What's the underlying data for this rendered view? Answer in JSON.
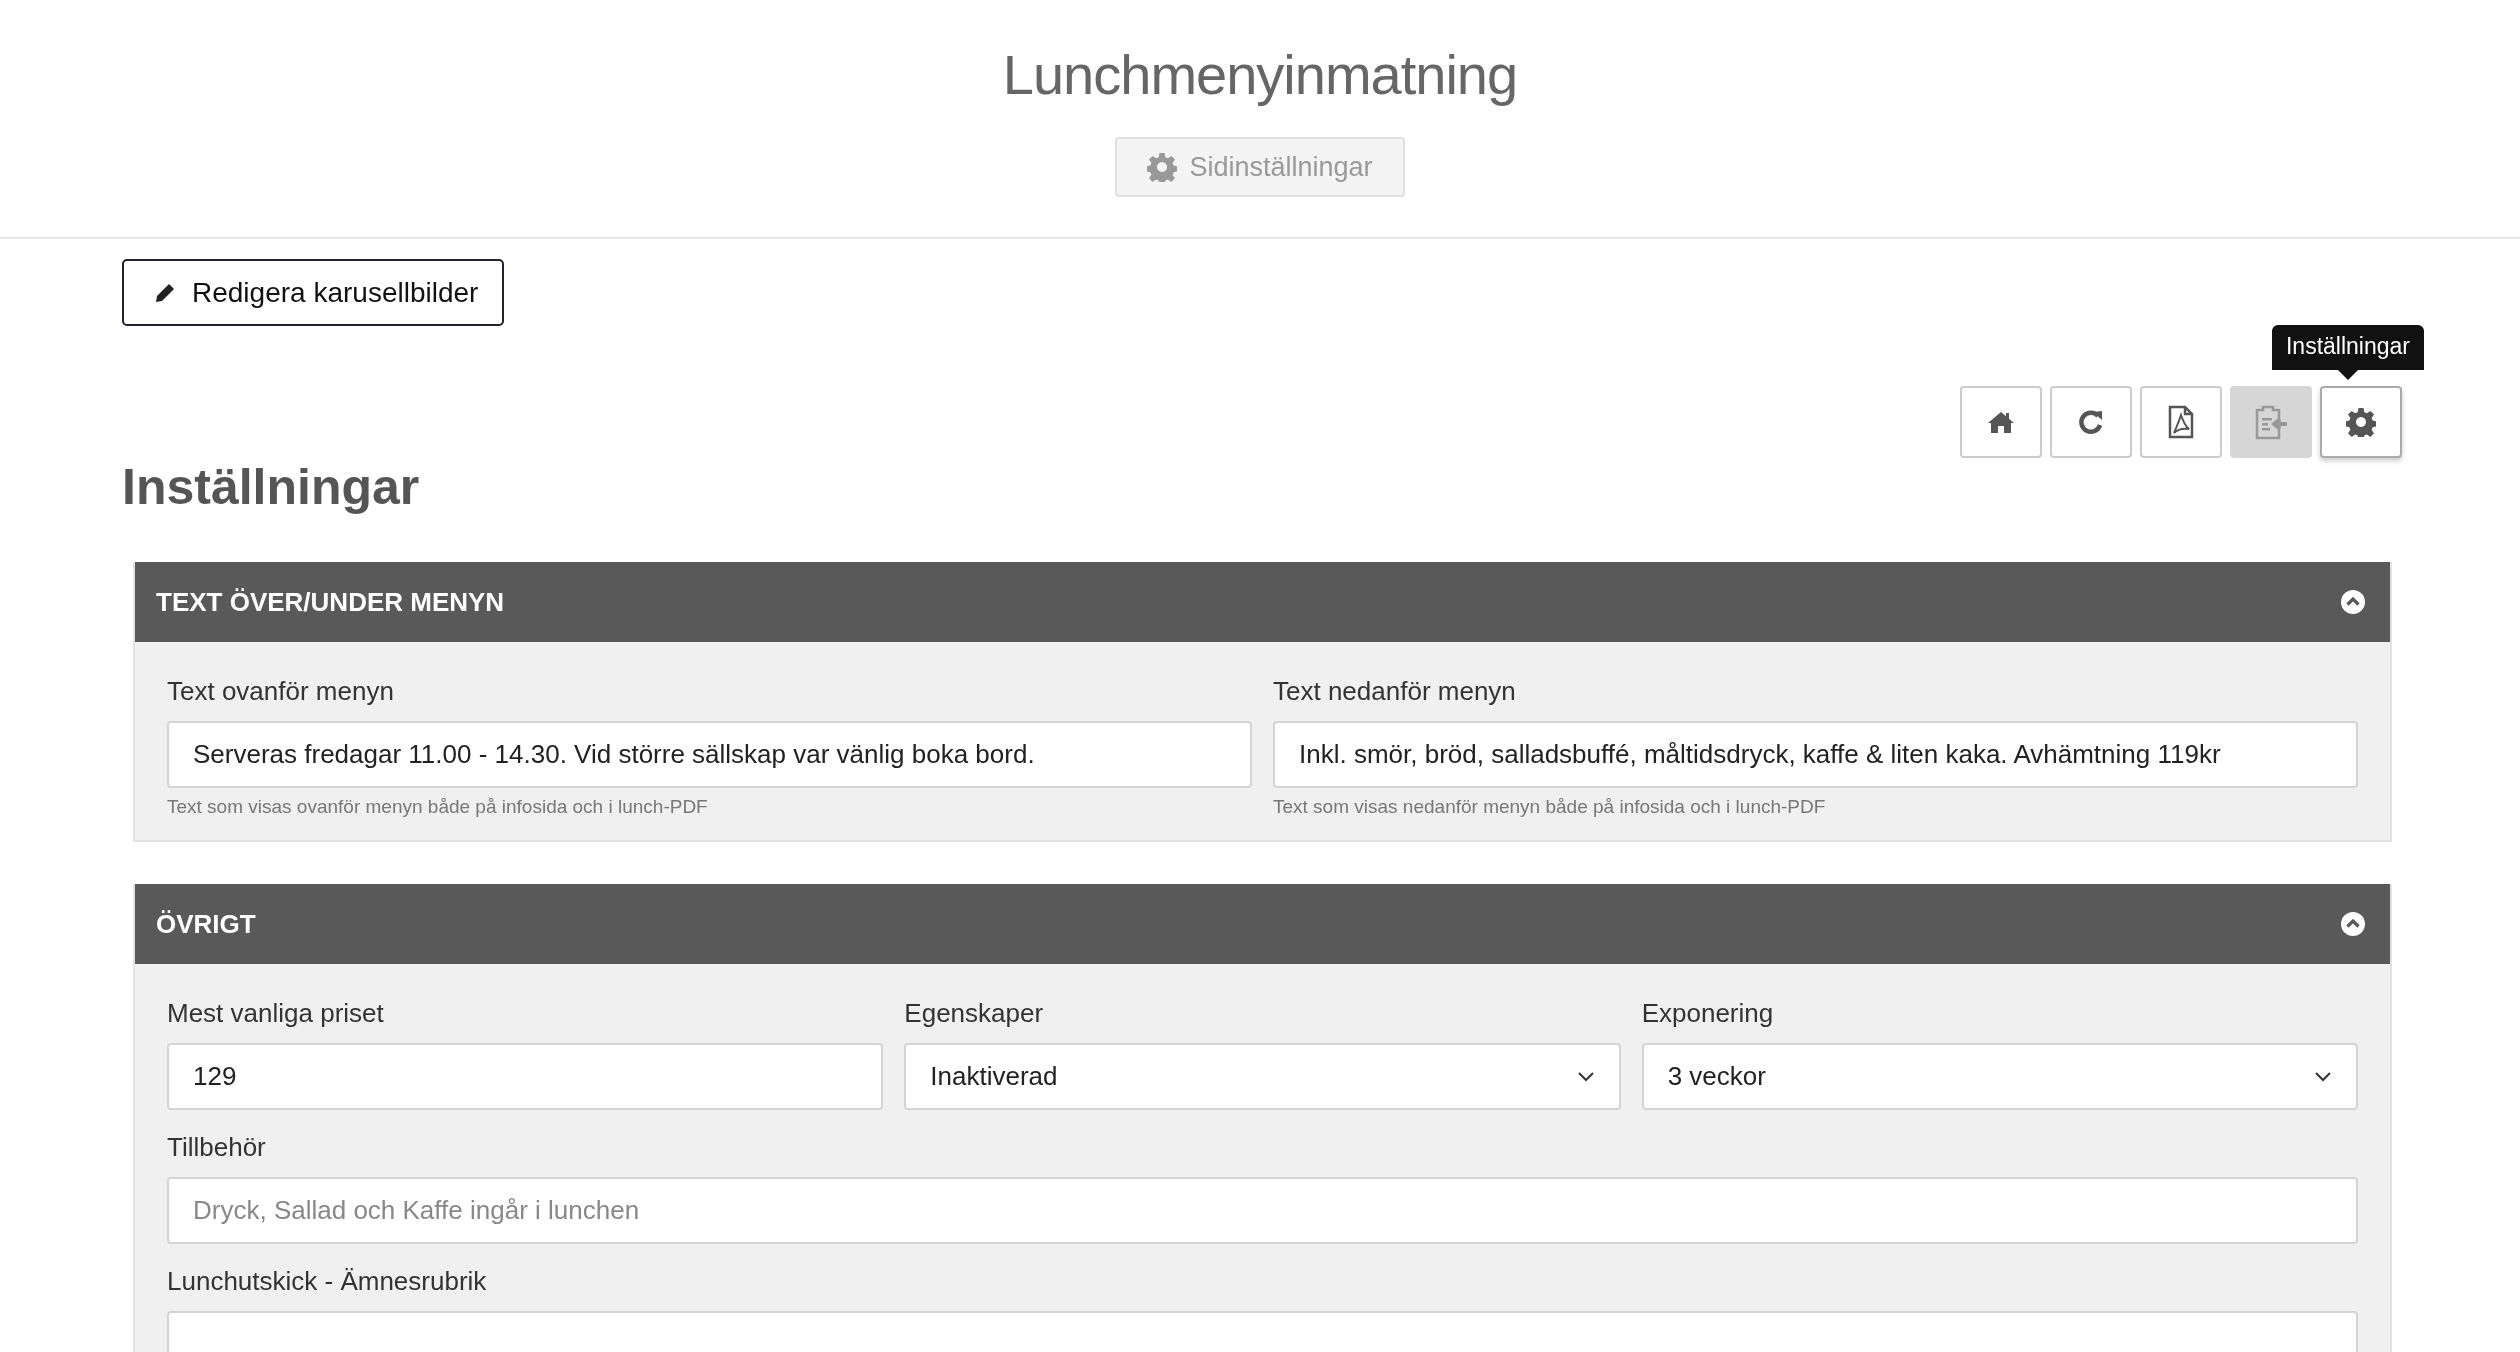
{
  "header": {
    "title": "Lunchmenyinmatning",
    "settings_button": {
      "label": "Sidinställningar",
      "disabled": true
    }
  },
  "edit_button": "Redigera karusellbilder",
  "toolbar": [
    {
      "kind": "home",
      "disabled": false,
      "focused": false
    },
    {
      "kind": "reload",
      "disabled": false,
      "focused": false
    },
    {
      "kind": "pdf",
      "disabled": false,
      "focused": false
    },
    {
      "kind": "import",
      "disabled": true,
      "focused": false
    },
    {
      "kind": "settings",
      "disabled": false,
      "focused": true
    }
  ],
  "tooltip": "Inställningar",
  "page_heading": "Inställningar",
  "panels": [
    {
      "title": "TEXT ÖVER/UNDER MENYN",
      "expanded": true,
      "rows": [
        [
          {
            "kind": "text",
            "label": "Text ovanför menyn",
            "value": "Serveras fredagar 11.00 - 14.30. Vid större sällskap var vänlig boka bord.",
            "help": "Text som visas ovanför menyn både på infosida och i lunch-PDF"
          },
          {
            "kind": "text",
            "label": "Text nedanför menyn",
            "value": "Inkl. smör, bröd, salladsbuffé, måltidsdryck, kaffe & liten kaka. Avhämtning 119kr",
            "help": "Text som visas nedanför menyn både på infosida och i lunch-PDF"
          }
        ]
      ]
    },
    {
      "title": "ÖVRIGT",
      "expanded": true,
      "rows": [
        [
          {
            "kind": "text",
            "label": "Mest vanliga priset",
            "value": "129"
          },
          {
            "kind": "select",
            "label": "Egenskaper",
            "value": "Inaktiverad"
          },
          {
            "kind": "select",
            "label": "Exponering",
            "value": "3 veckor"
          }
        ],
        [
          {
            "kind": "text",
            "label": "Tillbehör",
            "placeholder": "Dryck, Sallad och Kaffe ingår i lunchen"
          }
        ],
        [
          {
            "kind": "text",
            "label": "Lunchutskick - Ämnesrubrik"
          }
        ]
      ]
    }
  ]
}
